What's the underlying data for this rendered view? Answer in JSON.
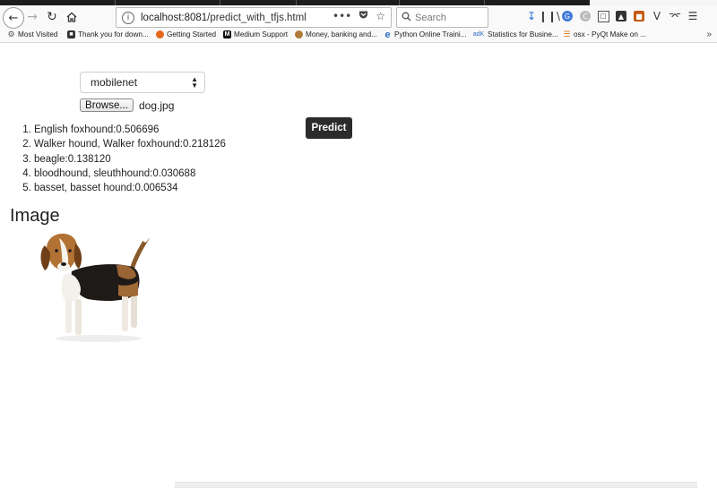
{
  "browser": {
    "url_host": "localhost:8081",
    "url_path": "/predict_with_tfjs.html",
    "search_placeholder": "Search",
    "page_actions": [
      "•••"
    ],
    "bookmarks": [
      {
        "label": "Most Visited",
        "icon": "gear-icon"
      },
      {
        "label": "Thank you for down...",
        "icon": "page-icon"
      },
      {
        "label": "Getting Started",
        "icon": "firefox-icon"
      },
      {
        "label": "Medium Support",
        "icon": "medium-icon"
      },
      {
        "label": "Money, banking and...",
        "icon": "leaf-icon"
      },
      {
        "label": "Python Online Traini...",
        "icon": "e-icon"
      },
      {
        "label": "Statistics for Busine...",
        "icon": "adk-icon"
      },
      {
        "label": "osx - PyQt Make on ...",
        "icon": "stack-icon"
      }
    ],
    "bookmarks_overflow": "»"
  },
  "form": {
    "model_selected": "mobilenet",
    "browse_label": "Browse...",
    "file_name": "dog.jpg",
    "predict_label": "Predict"
  },
  "results": [
    {
      "text": "English foxhound:0.506696"
    },
    {
      "text": "Walker hound, Walker foxhound:0.218126"
    },
    {
      "text": "beagle:0.138120"
    },
    {
      "text": "bloodhound, sleuthhound:0.030688"
    },
    {
      "text": "basset, basset hound:0.006534"
    }
  ],
  "image_heading": "Image"
}
